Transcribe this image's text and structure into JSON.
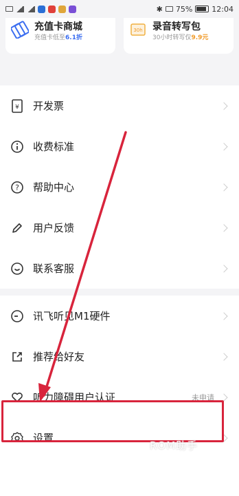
{
  "status_bar": {
    "battery": "75%",
    "time": "12:04"
  },
  "cards": [
    {
      "title": "充值卡商城",
      "sub_prefix": "充值卡低至",
      "sub_highlight": "6.1折",
      "icon": "card-icon"
    },
    {
      "title": "录音转写包",
      "sub_prefix": "30小时转写仅",
      "sub_highlight": "9.9元",
      "icon": "transcribe-package-icon"
    }
  ],
  "menu_group_1": [
    {
      "label": "开发票",
      "icon": "invoice-icon"
    },
    {
      "label": "收费标准",
      "icon": "info-icon"
    },
    {
      "label": "帮助中心",
      "icon": "help-icon"
    },
    {
      "label": "用户反馈",
      "icon": "pen-icon"
    },
    {
      "label": "联系客服",
      "icon": "chat-icon"
    }
  ],
  "menu_group_2": [
    {
      "label": "讯飞听见M1硬件",
      "icon": "device-icon",
      "status": ""
    },
    {
      "label": "推荐给好友",
      "icon": "share-icon",
      "status": ""
    },
    {
      "label": "听力障碍用户认证",
      "icon": "heart-icon",
      "status": "未申请"
    },
    {
      "label": "设置",
      "icon": "gear-icon",
      "status": ""
    }
  ],
  "watermark": "ROM助手",
  "colors": {
    "highlight": "#d8243c",
    "accent_blue": "#3a6df0",
    "accent_orange": "#f09a28"
  }
}
